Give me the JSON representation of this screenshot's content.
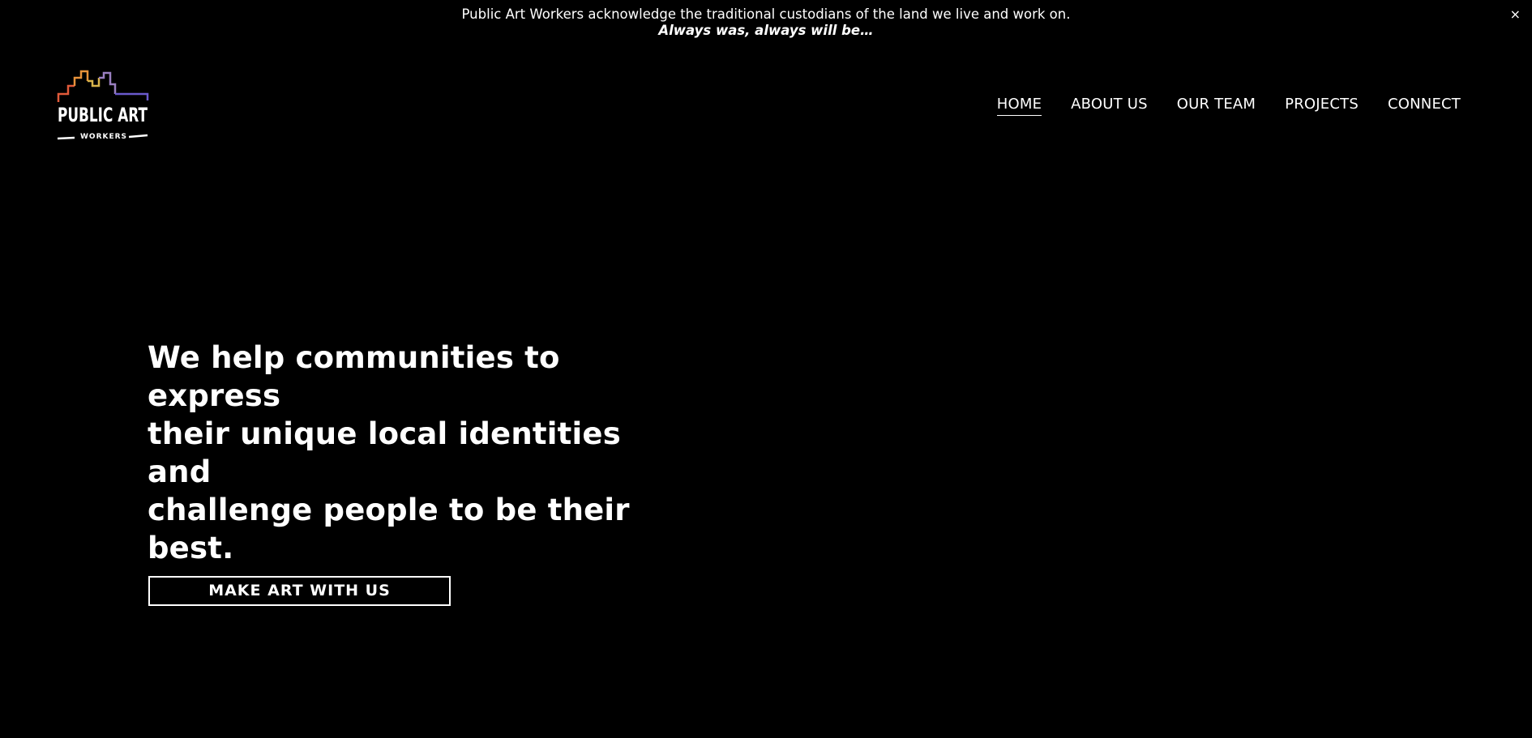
{
  "announcement": {
    "line1": "Public Art Workers acknowledge the traditional custodians of the land we live and work on.",
    "line2": "Always was, always will be…",
    "close_label": "×"
  },
  "logo": {
    "wordmark": "PUBLIC ART",
    "subtext": "WORKERS",
    "skyline_colors": [
      "#e05a3a",
      "#e8923a",
      "#d9b44a",
      "#9a7fc0",
      "#6a5acd"
    ]
  },
  "nav": {
    "items": [
      {
        "label": "HOME",
        "active": true
      },
      {
        "label": "ABOUT US",
        "active": false
      },
      {
        "label": "OUR TEAM",
        "active": false
      },
      {
        "label": "PROJECTS",
        "active": false
      },
      {
        "label": "CONNECT",
        "active": false
      }
    ]
  },
  "hero": {
    "headline_lines": [
      "We help communities to express",
      "their unique local identities and",
      "challenge people to be their best."
    ],
    "cta_label": "MAKE ART WITH US"
  },
  "colors": {
    "background": "#000000",
    "text": "#ffffff"
  }
}
